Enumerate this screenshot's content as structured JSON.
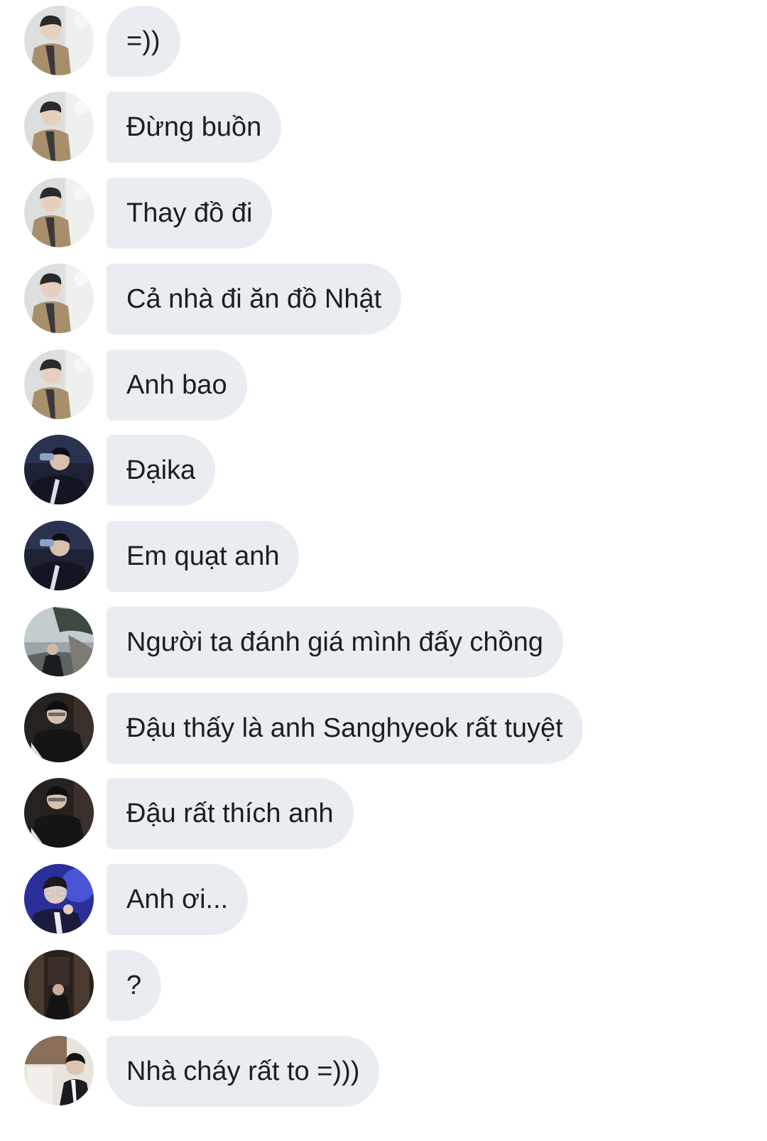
{
  "conversation": {
    "messages": [
      {
        "text": "=))",
        "avatar": "avatar-beige-suit"
      },
      {
        "text": "Đừng buồn",
        "avatar": "avatar-beige-suit"
      },
      {
        "text": "Thay đồ đi",
        "avatar": "avatar-beige-suit"
      },
      {
        "text": "Cả nhà đi ăn đồ Nhật",
        "avatar": "avatar-beige-suit"
      },
      {
        "text": "Anh bao",
        "avatar": "avatar-beige-suit"
      },
      {
        "text": "Đạika",
        "avatar": "avatar-navy-drinking"
      },
      {
        "text": "Em quạt anh",
        "avatar": "avatar-navy-drinking"
      },
      {
        "text": "Người ta đánh giá mình đấy chồng",
        "avatar": "avatar-outdoor-tree"
      },
      {
        "text": "Đậu thấy là anh Sanghyeok rất tuyệt",
        "avatar": "avatar-dark-jacket"
      },
      {
        "text": "Đậu rất thích anh",
        "avatar": "avatar-dark-jacket"
      },
      {
        "text": "Anh ơi...",
        "avatar": "avatar-blue-glasses"
      },
      {
        "text": "?",
        "avatar": "avatar-dark-room"
      },
      {
        "text": "Nhà cháy rất to =)))",
        "avatar": "avatar-light-room"
      }
    ]
  },
  "colors": {
    "bubble_background": "#e9edf1",
    "message_text": "#1c1e21",
    "page_background": "#ffffff"
  }
}
